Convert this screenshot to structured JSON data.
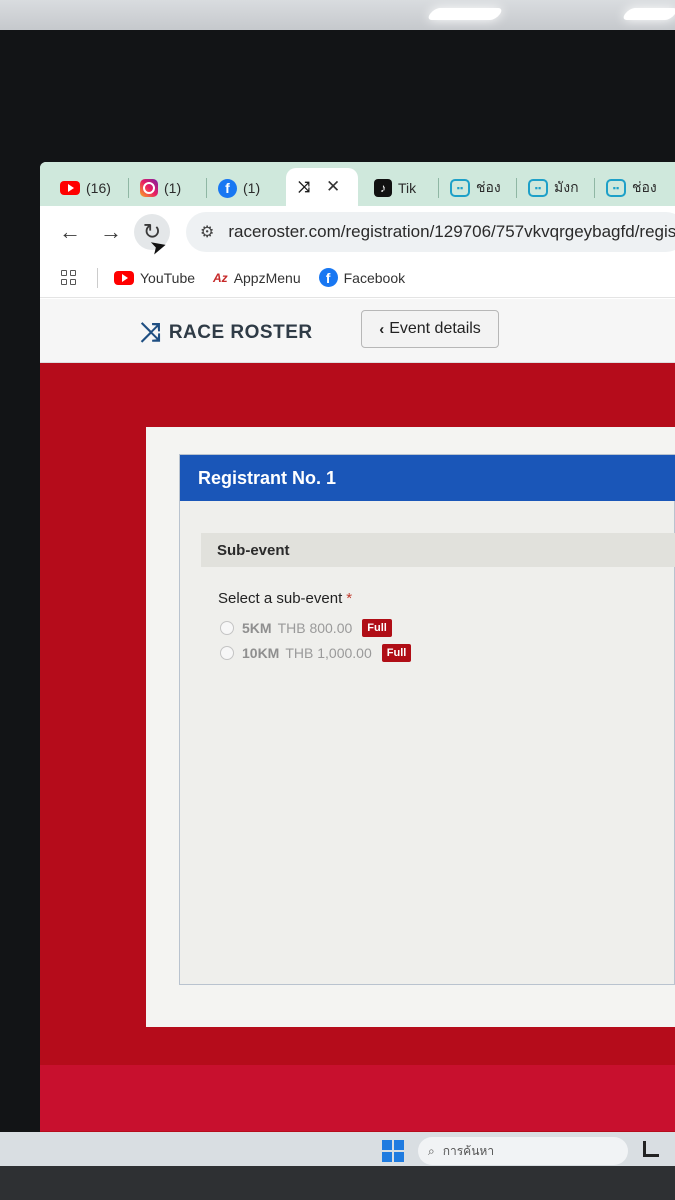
{
  "browser": {
    "tabs": [
      {
        "icon": "youtube-icon",
        "label": "(16)"
      },
      {
        "icon": "instagram-icon",
        "label": "(1)"
      },
      {
        "icon": "facebook-icon",
        "label": "(1)"
      },
      {
        "icon": "raceroster-icon",
        "label": "",
        "active": true
      },
      {
        "icon": "tiktok-icon",
        "label": "Tik"
      },
      {
        "icon": "twitch-icon",
        "label": "ช่อง"
      },
      {
        "icon": "twitch-icon",
        "label": "มังก"
      },
      {
        "icon": "twitch-icon",
        "label": "ช่อง"
      }
    ],
    "url": "raceroster.com/registration/129706/757vkvqrgeybagfd/registra",
    "bookmarks": [
      {
        "icon": "youtube-icon",
        "label": "YouTube"
      },
      {
        "icon": "appzmenu-icon",
        "label": "AppzMenu"
      },
      {
        "icon": "facebook-icon",
        "label": "Facebook"
      }
    ]
  },
  "site": {
    "logo_text": "RACE ROSTER",
    "event_details_label": "Event details"
  },
  "registration": {
    "title": "Registrant No. 1",
    "section_title": "Sub-event",
    "field_label": "Select a sub-event",
    "required_marker": "*",
    "options": [
      {
        "name": "5KM",
        "price": "THB 800.00",
        "status": "Full"
      },
      {
        "name": "10KM",
        "price": "THB 1,000.00",
        "status": "Full"
      }
    ]
  },
  "taskbar": {
    "search_placeholder": "การค้นหา"
  },
  "colors": {
    "brand_red": "#b50c1b",
    "header_blue": "#1a56b8",
    "badge_red": "#b00e16",
    "tab_strip": "#cfe8dc"
  }
}
